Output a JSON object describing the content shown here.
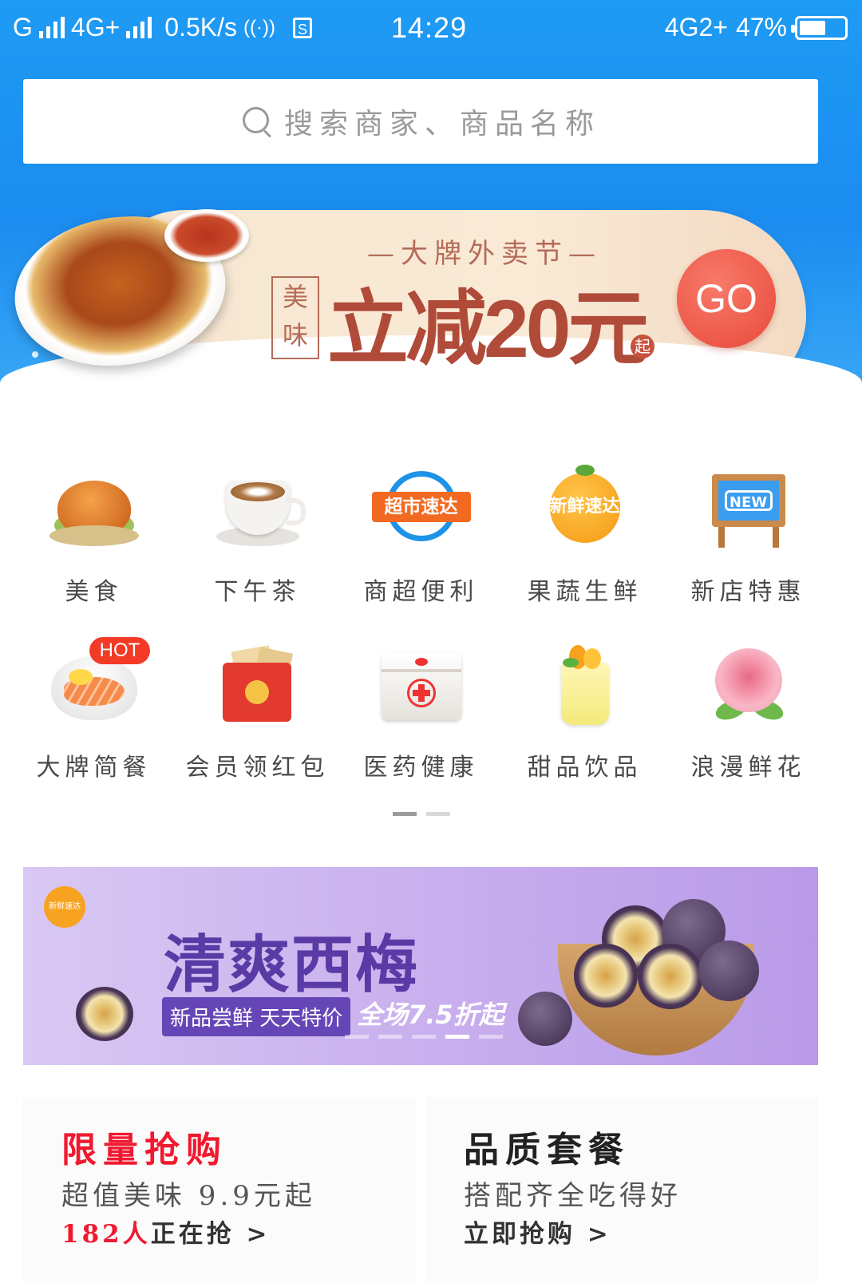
{
  "status_bar": {
    "carrier1": "G",
    "network": "4G+",
    "speed": "0.5K/s",
    "sim": "S",
    "time": "14:29",
    "right_network": "4G2+",
    "battery": "47%"
  },
  "search": {
    "placeholder": "搜索商家、商品名称"
  },
  "promo_banner": {
    "subtitle": "—大牌外卖节—",
    "tag": "美味",
    "headline": "立减20元",
    "suffix": "起",
    "button": "GO"
  },
  "categories": [
    {
      "label": "美食",
      "icon": "roast-chicken-icon"
    },
    {
      "label": "下午茶",
      "icon": "coffee-cup-icon"
    },
    {
      "label": "商超便利",
      "icon": "supermarket-express-icon"
    },
    {
      "label": "果蔬生鲜",
      "icon": "fresh-express-icon"
    },
    {
      "label": "新店特惠",
      "icon": "new-sign-icon"
    },
    {
      "label": "大牌简餐",
      "icon": "salmon-dish-icon"
    },
    {
      "label": "会员领红包",
      "icon": "red-envelope-icon"
    },
    {
      "label": "医药健康",
      "icon": "first-aid-kit-icon"
    },
    {
      "label": "甜品饮品",
      "icon": "juice-cup-icon"
    },
    {
      "label": "浪漫鲜花",
      "icon": "rose-icon"
    }
  ],
  "badges": {
    "hot": "HOT",
    "supermarket": "超市速达",
    "fresh": "新鲜速达",
    "new": "NEW"
  },
  "fruit_banner": {
    "title": "清爽西梅",
    "pill": "新品尝鲜 天天特价",
    "discount": "全场7.5折起",
    "badge": "新鲜速达"
  },
  "cards": [
    {
      "title": "限量抢购",
      "subtitle": "超值美味 9.9元起",
      "count": "182人",
      "footer": "正在抢 >"
    },
    {
      "title": "品质套餐",
      "subtitle": "搭配齐全吃得好",
      "footer": "立即抢购 >"
    }
  ],
  "colors": {
    "header_blue": "#1e9bf4",
    "accent_red": "#f0192f",
    "promo_red": "#b04b39"
  }
}
